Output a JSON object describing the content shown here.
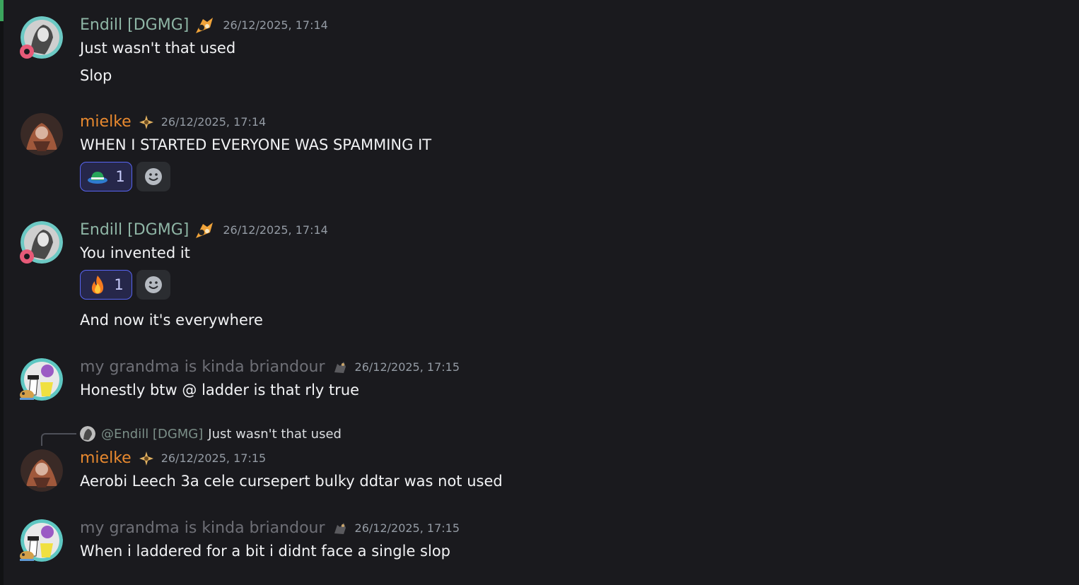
{
  "colors": {
    "background": "#1a1a1e",
    "endill_name": "#8fb6a6",
    "mielke_name": "#e8892f",
    "grandma_name": "#6e6f76",
    "reaction_border": "#5865f2"
  },
  "messages": [
    {
      "author": "Endill [DGMG]",
      "timestamp": "26/12/2025, 17:14",
      "lines": [
        "Just wasn't that used",
        "Slop"
      ]
    },
    {
      "author": "mielke",
      "timestamp": "26/12/2025, 17:14",
      "lines": [
        "WHEN I STARTED EVERYONE WAS SPAMMING IT"
      ],
      "reactions": [
        {
          "emoji": "hat-emoji",
          "count": "1"
        }
      ]
    },
    {
      "author": "Endill [DGMG]",
      "timestamp": "26/12/2025, 17:14",
      "lines": [
        "You invented it",
        "And now it's everywhere"
      ],
      "reactions": [
        {
          "emoji": "fire-emoji",
          "count": "1"
        }
      ]
    },
    {
      "author": "my grandma is kinda briandour",
      "timestamp": "26/12/2025, 17:15",
      "lines": [
        "Honestly btw @ ladder is that rly true"
      ]
    },
    {
      "reply": {
        "author": "@Endill [DGMG]",
        "text": "Just wasn't that used"
      },
      "author": "mielke",
      "timestamp": "26/12/2025, 17:15",
      "lines": [
        "Aerobi Leech 3a cele cursepert bulky ddtar was not used"
      ]
    },
    {
      "author": "my grandma is kinda briandour",
      "timestamp": "26/12/2025, 17:15",
      "lines": [
        "When i laddered for a bit i didnt face a single slop"
      ]
    }
  ]
}
